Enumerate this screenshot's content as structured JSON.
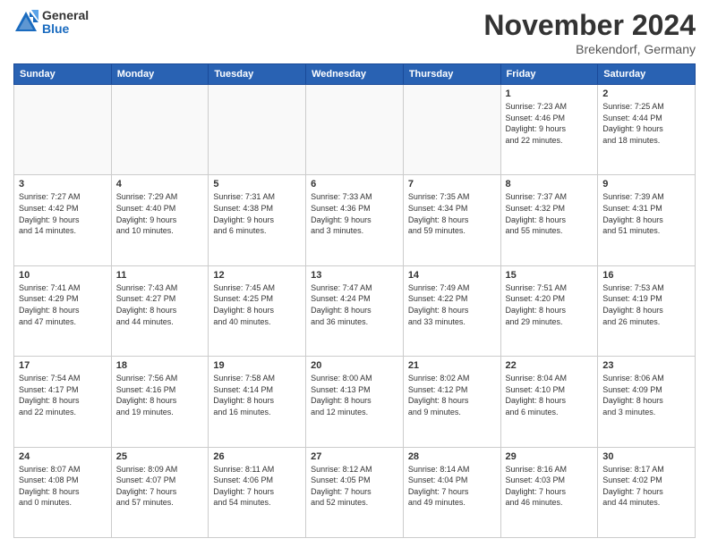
{
  "logo": {
    "general": "General",
    "blue": "Blue"
  },
  "title": "November 2024",
  "location": "Brekendorf, Germany",
  "weekdays": [
    "Sunday",
    "Monday",
    "Tuesday",
    "Wednesday",
    "Thursday",
    "Friday",
    "Saturday"
  ],
  "weeks": [
    [
      {
        "day": "",
        "info": ""
      },
      {
        "day": "",
        "info": ""
      },
      {
        "day": "",
        "info": ""
      },
      {
        "day": "",
        "info": ""
      },
      {
        "day": "",
        "info": ""
      },
      {
        "day": "1",
        "info": "Sunrise: 7:23 AM\nSunset: 4:46 PM\nDaylight: 9 hours\nand 22 minutes."
      },
      {
        "day": "2",
        "info": "Sunrise: 7:25 AM\nSunset: 4:44 PM\nDaylight: 9 hours\nand 18 minutes."
      }
    ],
    [
      {
        "day": "3",
        "info": "Sunrise: 7:27 AM\nSunset: 4:42 PM\nDaylight: 9 hours\nand 14 minutes."
      },
      {
        "day": "4",
        "info": "Sunrise: 7:29 AM\nSunset: 4:40 PM\nDaylight: 9 hours\nand 10 minutes."
      },
      {
        "day": "5",
        "info": "Sunrise: 7:31 AM\nSunset: 4:38 PM\nDaylight: 9 hours\nand 6 minutes."
      },
      {
        "day": "6",
        "info": "Sunrise: 7:33 AM\nSunset: 4:36 PM\nDaylight: 9 hours\nand 3 minutes."
      },
      {
        "day": "7",
        "info": "Sunrise: 7:35 AM\nSunset: 4:34 PM\nDaylight: 8 hours\nand 59 minutes."
      },
      {
        "day": "8",
        "info": "Sunrise: 7:37 AM\nSunset: 4:32 PM\nDaylight: 8 hours\nand 55 minutes."
      },
      {
        "day": "9",
        "info": "Sunrise: 7:39 AM\nSunset: 4:31 PM\nDaylight: 8 hours\nand 51 minutes."
      }
    ],
    [
      {
        "day": "10",
        "info": "Sunrise: 7:41 AM\nSunset: 4:29 PM\nDaylight: 8 hours\nand 47 minutes."
      },
      {
        "day": "11",
        "info": "Sunrise: 7:43 AM\nSunset: 4:27 PM\nDaylight: 8 hours\nand 44 minutes."
      },
      {
        "day": "12",
        "info": "Sunrise: 7:45 AM\nSunset: 4:25 PM\nDaylight: 8 hours\nand 40 minutes."
      },
      {
        "day": "13",
        "info": "Sunrise: 7:47 AM\nSunset: 4:24 PM\nDaylight: 8 hours\nand 36 minutes."
      },
      {
        "day": "14",
        "info": "Sunrise: 7:49 AM\nSunset: 4:22 PM\nDaylight: 8 hours\nand 33 minutes."
      },
      {
        "day": "15",
        "info": "Sunrise: 7:51 AM\nSunset: 4:20 PM\nDaylight: 8 hours\nand 29 minutes."
      },
      {
        "day": "16",
        "info": "Sunrise: 7:53 AM\nSunset: 4:19 PM\nDaylight: 8 hours\nand 26 minutes."
      }
    ],
    [
      {
        "day": "17",
        "info": "Sunrise: 7:54 AM\nSunset: 4:17 PM\nDaylight: 8 hours\nand 22 minutes."
      },
      {
        "day": "18",
        "info": "Sunrise: 7:56 AM\nSunset: 4:16 PM\nDaylight: 8 hours\nand 19 minutes."
      },
      {
        "day": "19",
        "info": "Sunrise: 7:58 AM\nSunset: 4:14 PM\nDaylight: 8 hours\nand 16 minutes."
      },
      {
        "day": "20",
        "info": "Sunrise: 8:00 AM\nSunset: 4:13 PM\nDaylight: 8 hours\nand 12 minutes."
      },
      {
        "day": "21",
        "info": "Sunrise: 8:02 AM\nSunset: 4:12 PM\nDaylight: 8 hours\nand 9 minutes."
      },
      {
        "day": "22",
        "info": "Sunrise: 8:04 AM\nSunset: 4:10 PM\nDaylight: 8 hours\nand 6 minutes."
      },
      {
        "day": "23",
        "info": "Sunrise: 8:06 AM\nSunset: 4:09 PM\nDaylight: 8 hours\nand 3 minutes."
      }
    ],
    [
      {
        "day": "24",
        "info": "Sunrise: 8:07 AM\nSunset: 4:08 PM\nDaylight: 8 hours\nand 0 minutes."
      },
      {
        "day": "25",
        "info": "Sunrise: 8:09 AM\nSunset: 4:07 PM\nDaylight: 7 hours\nand 57 minutes."
      },
      {
        "day": "26",
        "info": "Sunrise: 8:11 AM\nSunset: 4:06 PM\nDaylight: 7 hours\nand 54 minutes."
      },
      {
        "day": "27",
        "info": "Sunrise: 8:12 AM\nSunset: 4:05 PM\nDaylight: 7 hours\nand 52 minutes."
      },
      {
        "day": "28",
        "info": "Sunrise: 8:14 AM\nSunset: 4:04 PM\nDaylight: 7 hours\nand 49 minutes."
      },
      {
        "day": "29",
        "info": "Sunrise: 8:16 AM\nSunset: 4:03 PM\nDaylight: 7 hours\nand 46 minutes."
      },
      {
        "day": "30",
        "info": "Sunrise: 8:17 AM\nSunset: 4:02 PM\nDaylight: 7 hours\nand 44 minutes."
      }
    ]
  ]
}
